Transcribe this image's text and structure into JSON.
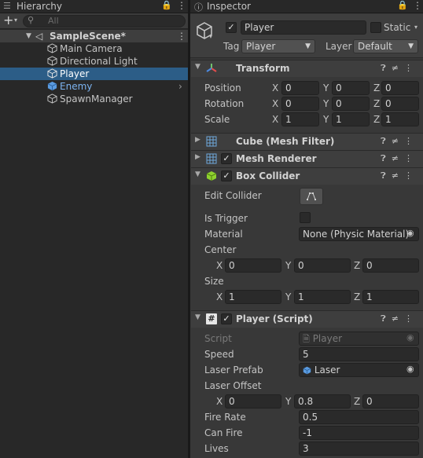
{
  "hierarchy": {
    "tab_label": "Hierarchy",
    "search_placeholder": "All",
    "add_label": "+",
    "scene_name": "SampleScene*",
    "items": [
      {
        "label": "Main Camera"
      },
      {
        "label": "Directional Light"
      },
      {
        "label": "Player"
      },
      {
        "label": "Enemy"
      },
      {
        "label": "SpawnManager"
      }
    ]
  },
  "inspector": {
    "tab_label": "Inspector",
    "object_name": "Player",
    "static_label": "Static",
    "tag_label": "Tag",
    "tag_value": "Player",
    "layer_label": "Layer",
    "layer_value": "Default",
    "transform": {
      "title": "Transform",
      "position_label": "Position",
      "rotation_label": "Rotation",
      "scale_label": "Scale",
      "axis_x": "X",
      "axis_y": "Y",
      "axis_z": "Z",
      "position": [
        "0",
        "0",
        "0"
      ],
      "rotation": [
        "0",
        "0",
        "0"
      ],
      "scale": [
        "1",
        "1",
        "1"
      ]
    },
    "mesh_filter": {
      "title": "Cube (Mesh Filter)"
    },
    "mesh_renderer": {
      "title": "Mesh Renderer"
    },
    "box_collider": {
      "title": "Box Collider",
      "edit_collider_label": "Edit Collider",
      "is_trigger_label": "Is Trigger",
      "material_label": "Material",
      "material_value": "None (Physic Material)",
      "center_label": "Center",
      "size_label": "Size",
      "center": [
        "0",
        "0",
        "0"
      ],
      "size": [
        "1",
        "1",
        "1"
      ]
    },
    "player_script": {
      "title": "Player (Script)",
      "script_label": "Script",
      "script_value": "Player",
      "speed_label": "Speed",
      "speed_value": "5",
      "laser_prefab_label": "Laser Prefab",
      "laser_prefab_value": "Laser",
      "laser_offset_label": "Laser Offset",
      "laser_offset": [
        "0",
        "0.8",
        "0"
      ],
      "fire_rate_label": "Fire Rate",
      "fire_rate_value": "0.5",
      "can_fire_label": "Can Fire",
      "can_fire_value": "-1",
      "lives_label": "Lives",
      "lives_value": "3"
    }
  },
  "colors": {
    "selection": "#2c5d87",
    "enemy_prefab_text": "#7cb3f0",
    "transform_icon": "#e24c4c",
    "collider_icon": "#8ed12e"
  }
}
